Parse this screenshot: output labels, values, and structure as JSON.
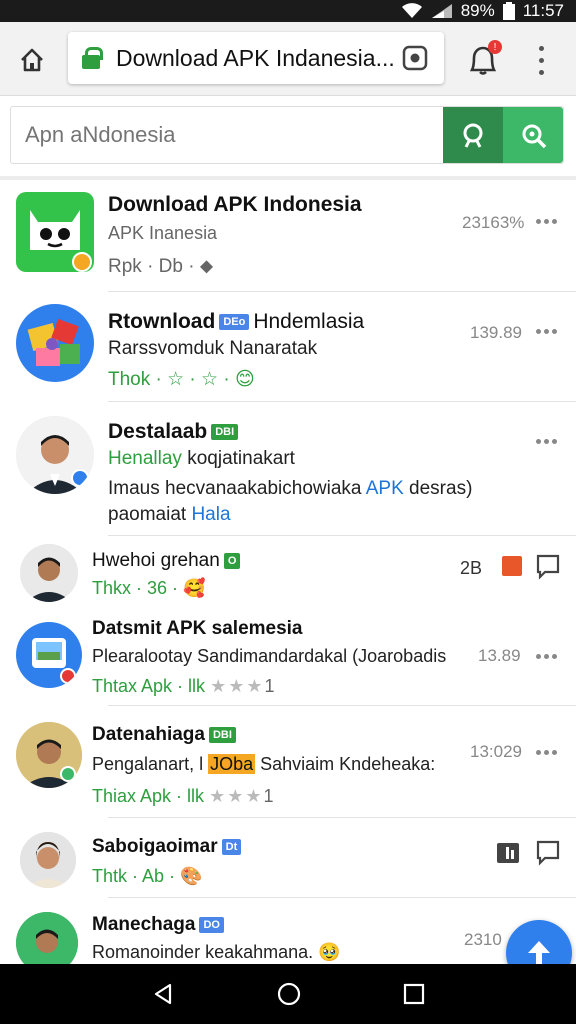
{
  "status_bar": {
    "battery": "89%",
    "time": "11:57"
  },
  "browser": {
    "url_title": "Download APK Indanesia...",
    "notification_count": "!"
  },
  "search": {
    "placeholder": "Apn aNdonesia"
  },
  "items": [
    {
      "title": "Download APK Indonesia",
      "line1": "APK Inanesia",
      "line2": "Rpk · Db ·",
      "stat": "23163%"
    },
    {
      "title": "Rtownload",
      "badge": "DEo",
      "title_rest": "Hndemlasia",
      "line1": "Rarssvomduk Nanaratak",
      "line2": "Thok · ☆ · ☆ ·",
      "stat": "139.89"
    },
    {
      "title": "Destalaab",
      "badge": "DBI",
      "line1_a": "Henallay",
      "line1_b": "koqjatinakart",
      "line2_a": "Imaus hecvanaakabichowiaka",
      "line2_link": "APK",
      "line2_b": "desras)",
      "line3_a": "paomaiat",
      "line3_link": "Hala"
    },
    {
      "title": "Hwehoi grehan",
      "badge": "O",
      "line1": "Thkx · 36 ·",
      "stat": "2B"
    },
    {
      "title": "Datsmit APK salemesia",
      "line1": "Plearalootay Sandimandardakal (Joarobadis",
      "line2_a": "Thtax Apk · llk",
      "stars": "★★★",
      "stars_tail": "1",
      "stat": "13.89"
    },
    {
      "title": "Datenahiaga",
      "badge": "DBI",
      "line1_a": "Pengalanart, l",
      "line1_highlight": "JOba",
      "line1_b": "Sahviaim Kndeheaka:",
      "line2_a": "Thiax Apk · llk",
      "stars": "★★★",
      "stars_tail": "1",
      "stat": "13:029"
    },
    {
      "title": "Saboigaoimar",
      "badge": "Dt",
      "line1": "Thtk · Ab ·"
    },
    {
      "title": "Manechaga",
      "badge": "DO",
      "line1": "Romanoinder keakahmana.",
      "stat": "2310"
    }
  ],
  "colors": {
    "accent_green": "#2e9e3e",
    "accent_blue": "#2f80ed",
    "search_btn_dark": "#2e8b4b",
    "search_btn_light": "#3cb868"
  }
}
